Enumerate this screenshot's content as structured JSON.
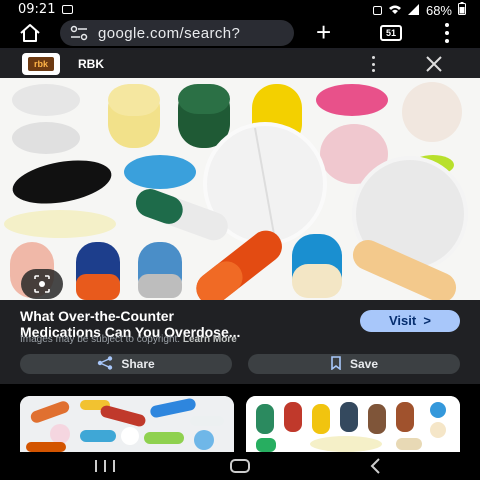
{
  "status_bar": {
    "time": "09:21",
    "battery": "68%"
  },
  "toolbar": {
    "url": "google.com/search?",
    "tab_count": "51"
  },
  "source": {
    "logo_text": "rbk",
    "name": "RBK"
  },
  "result": {
    "title_line1": "What Over-the-Counter",
    "title_line2": "Medications Can You Overdose...",
    "visit_label": "Visit",
    "copyright_text": "Images may be subject to copyright.",
    "learn_more": "Learn More",
    "share_label": "Share",
    "save_label": "Save"
  },
  "colors": {
    "accent": "#a8c7fa",
    "panel": "#202124",
    "button": "#3c4043"
  },
  "icons": [
    "home-icon",
    "site-settings-icon",
    "plus-icon",
    "tabs-icon",
    "overflow-menu-icon",
    "close-icon",
    "lens-icon",
    "share-icon",
    "bookmark-icon",
    "recent-apps-icon",
    "nav-home-icon",
    "back-icon"
  ]
}
